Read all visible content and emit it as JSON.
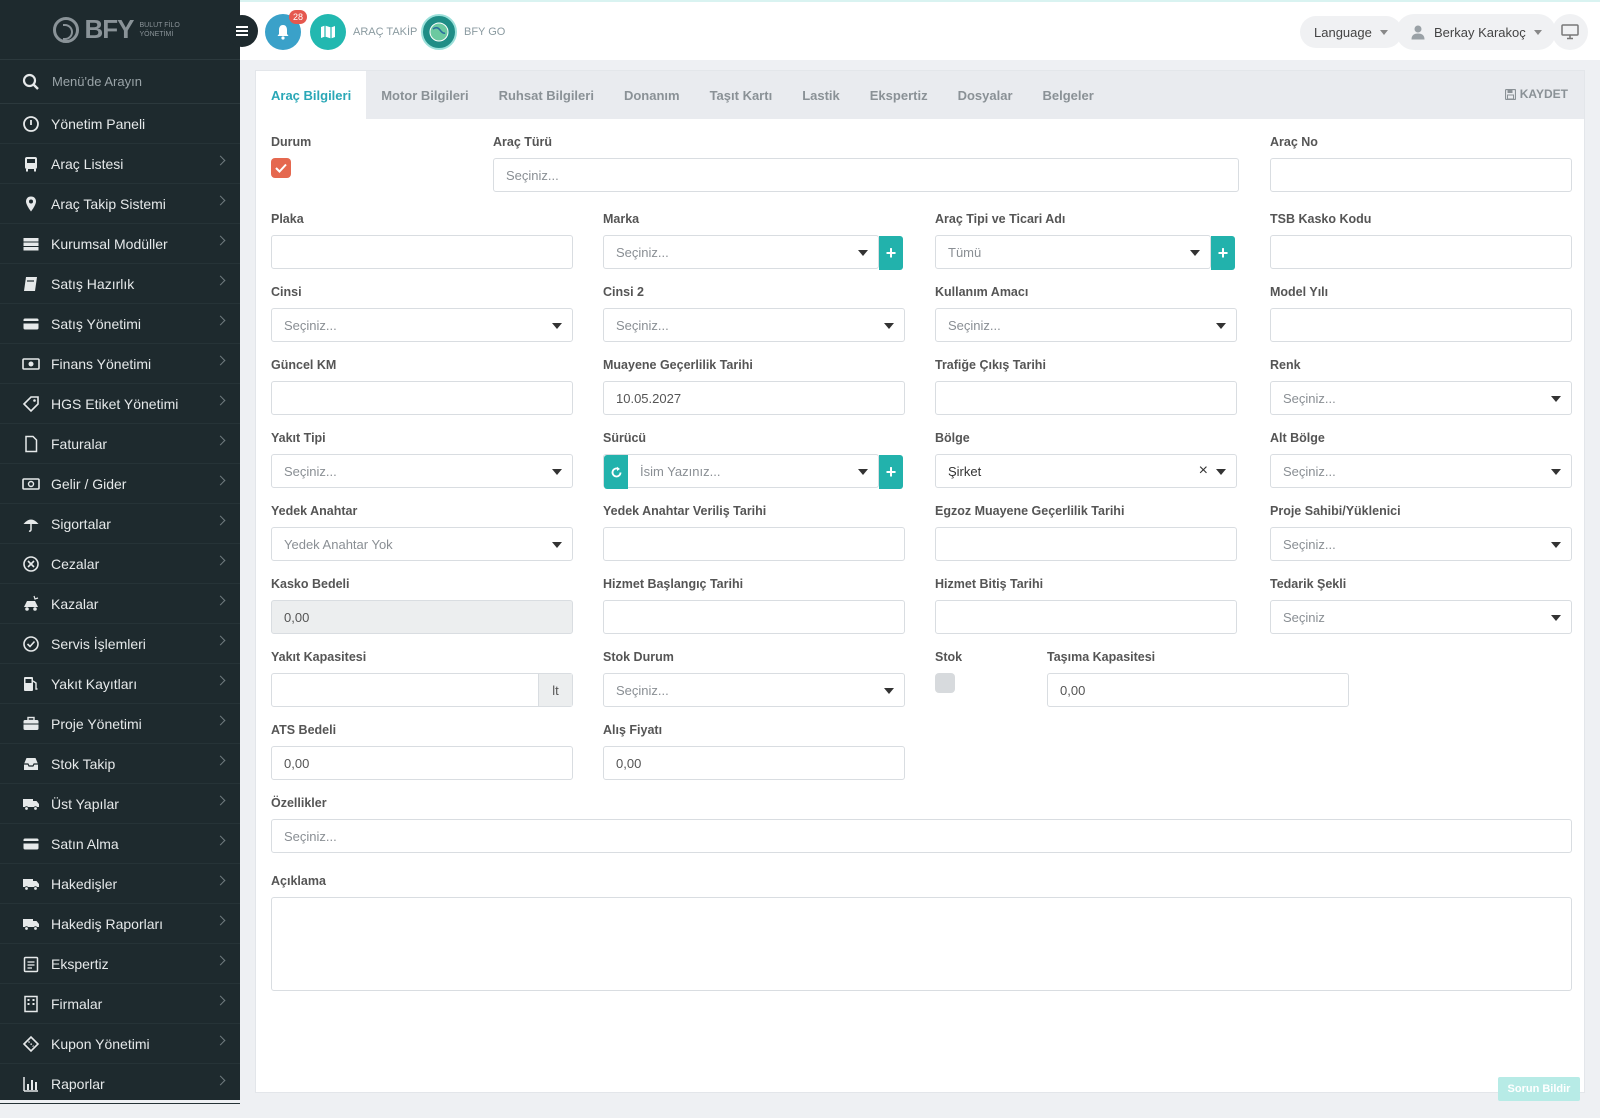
{
  "brand": {
    "name": "BFY",
    "subtitle": "BULUT FİLO YÖNETİMİ"
  },
  "sidebar": {
    "search_placeholder": "Menü'de Arayın",
    "items": [
      {
        "label": "Yönetim Paneli",
        "icon": "dashboard-icon",
        "has_submenu": false
      },
      {
        "label": "Araç Listesi",
        "icon": "bus-icon",
        "has_submenu": true
      },
      {
        "label": "Araç Takip Sistemi",
        "icon": "map-pin-icon",
        "has_submenu": true
      },
      {
        "label": "Kurumsal Modüller",
        "icon": "server-icon",
        "has_submenu": true
      },
      {
        "label": "Satış Hazırlık",
        "icon": "book-icon",
        "has_submenu": true
      },
      {
        "label": "Satış Yönetimi",
        "icon": "credit-card-icon",
        "has_submenu": true
      },
      {
        "label": "Finans Yönetimi",
        "icon": "money-icon",
        "has_submenu": true
      },
      {
        "label": "HGS Etiket Yönetimi",
        "icon": "tag-icon",
        "has_submenu": true
      },
      {
        "label": "Faturalar",
        "icon": "file-icon",
        "has_submenu": true
      },
      {
        "label": "Gelir / Gider",
        "icon": "cash-icon",
        "has_submenu": true
      },
      {
        "label": "Sigortalar",
        "icon": "umbrella-icon",
        "has_submenu": true
      },
      {
        "label": "Cezalar",
        "icon": "x-circle-icon",
        "has_submenu": true
      },
      {
        "label": "Kazalar",
        "icon": "car-crash-icon",
        "has_submenu": true
      },
      {
        "label": "Servis İşlemleri",
        "icon": "check-circle-icon",
        "has_submenu": true
      },
      {
        "label": "Yakıt Kayıtları",
        "icon": "fuel-icon",
        "has_submenu": true
      },
      {
        "label": "Proje Yönetimi",
        "icon": "briefcase-icon",
        "has_submenu": true
      },
      {
        "label": "Stok Takip",
        "icon": "inbox-icon",
        "has_submenu": true
      },
      {
        "label": "Üst Yapılar",
        "icon": "truck-icon",
        "has_submenu": true
      },
      {
        "label": "Satın Alma",
        "icon": "credit-card-icon",
        "has_submenu": true
      },
      {
        "label": "Hakedişler",
        "icon": "truck-icon",
        "has_submenu": true
      },
      {
        "label": "Hakediş Raporları",
        "icon": "truck-icon",
        "has_submenu": true
      },
      {
        "label": "Ekspertiz",
        "icon": "clipboard-icon",
        "has_submenu": true
      },
      {
        "label": "Firmalar",
        "icon": "building-icon",
        "has_submenu": true
      },
      {
        "label": "Kupon Yönetimi",
        "icon": "ticket-icon",
        "has_submenu": true
      },
      {
        "label": "Raporlar",
        "icon": "bar-chart-icon",
        "has_submenu": true
      }
    ]
  },
  "header": {
    "notification_count": "28",
    "arac_takip_label": "ARAÇ TAKİP",
    "bfy_go_label": "BFY GO",
    "language_label": "Language",
    "user_name": "Berkay Karakoç"
  },
  "tabs": [
    {
      "label": "Araç Bilgileri",
      "active": true
    },
    {
      "label": "Motor Bilgileri",
      "active": false
    },
    {
      "label": "Ruhsat Bilgileri",
      "active": false
    },
    {
      "label": "Donanım",
      "active": false
    },
    {
      "label": "Taşıt Kartı",
      "active": false
    },
    {
      "label": "Lastik",
      "active": false
    },
    {
      "label": "Ekspertiz",
      "active": false
    },
    {
      "label": "Dosyalar",
      "active": false
    },
    {
      "label": "Belgeler",
      "active": false
    }
  ],
  "save_label": "KAYDET",
  "form": {
    "durum": {
      "label": "Durum",
      "checked": true
    },
    "arac_turu": {
      "label": "Araç Türü",
      "placeholder": "Seçiniz..."
    },
    "arac_no": {
      "label": "Araç No",
      "value": ""
    },
    "plaka": {
      "label": "Plaka",
      "value": ""
    },
    "marka": {
      "label": "Marka",
      "placeholder": "Seçiniz..."
    },
    "arac_tipi": {
      "label": "Araç Tipi ve Ticari Adı",
      "value": "Tümü"
    },
    "tsb_kasko": {
      "label": "TSB Kasko Kodu",
      "value": ""
    },
    "cinsi": {
      "label": "Cinsi",
      "placeholder": "Seçiniz..."
    },
    "cinsi2": {
      "label": "Cinsi 2",
      "placeholder": "Seçiniz..."
    },
    "kullanim_amaci": {
      "label": "Kullanım Amacı",
      "placeholder": "Seçiniz..."
    },
    "model_yili": {
      "label": "Model Yılı",
      "value": ""
    },
    "guncel_km": {
      "label": "Güncel KM",
      "value": ""
    },
    "muayene_tarihi": {
      "label": "Muayene Geçerlilik Tarihi",
      "value": "10.05.2027"
    },
    "trafige_cikis": {
      "label": "Trafiğe Çıkış Tarihi",
      "value": ""
    },
    "renk": {
      "label": "Renk",
      "placeholder": "Seçiniz..."
    },
    "yakit_tipi": {
      "label": "Yakıt Tipi",
      "placeholder": "Seçiniz..."
    },
    "surucu": {
      "label": "Sürücü",
      "placeholder": "İsim Yazınız..."
    },
    "bolge": {
      "label": "Bölge",
      "value": "Şirket"
    },
    "alt_bolge": {
      "label": "Alt Bölge",
      "placeholder": "Seçiniz..."
    },
    "yedek_anahtar": {
      "label": "Yedek Anahtar",
      "value": "Yedek Anahtar Yok"
    },
    "yedek_anahtar_tarih": {
      "label": "Yedek Anahtar Veriliş Tarihi",
      "value": ""
    },
    "egzoz_muayene": {
      "label": "Egzoz Muayene Geçerlilik Tarihi",
      "value": ""
    },
    "proje_sahibi": {
      "label": "Proje Sahibi/Yüklenici",
      "placeholder": "Seçiniz..."
    },
    "kasko_bedeli": {
      "label": "Kasko Bedeli",
      "value": "0,00"
    },
    "hizmet_baslangic": {
      "label": "Hizmet Başlangıç Tarihi",
      "value": ""
    },
    "hizmet_bitis": {
      "label": "Hizmet Bitiş Tarihi",
      "value": ""
    },
    "tedarik_sekli": {
      "label": "Tedarik Şekli",
      "value": "Seçiniz"
    },
    "yakit_kapasitesi": {
      "label": "Yakıt Kapasitesi",
      "value": "",
      "unit": "lt"
    },
    "stok_durum": {
      "label": "Stok Durum",
      "placeholder": "Seçiniz..."
    },
    "stok": {
      "label": "Stok",
      "checked": false
    },
    "tasima_kapasitesi": {
      "label": "Taşıma Kapasitesi",
      "value": "0,00"
    },
    "ats_bedeli": {
      "label": "ATS Bedeli",
      "value": "0,00"
    },
    "alis_fiyati": {
      "label": "Alış Fiyatı",
      "value": "0,00"
    },
    "ozellikler": {
      "label": "Özellikler",
      "placeholder": "Seçiniz..."
    },
    "aciklama": {
      "label": "Açıklama",
      "value": ""
    }
  },
  "report_button": "Sorun Bildir",
  "colors": {
    "accent": "#2aa7b6",
    "teal": "#22b2ac",
    "checkbox": "#e5684f",
    "sidebar": "#1e2a2e"
  }
}
